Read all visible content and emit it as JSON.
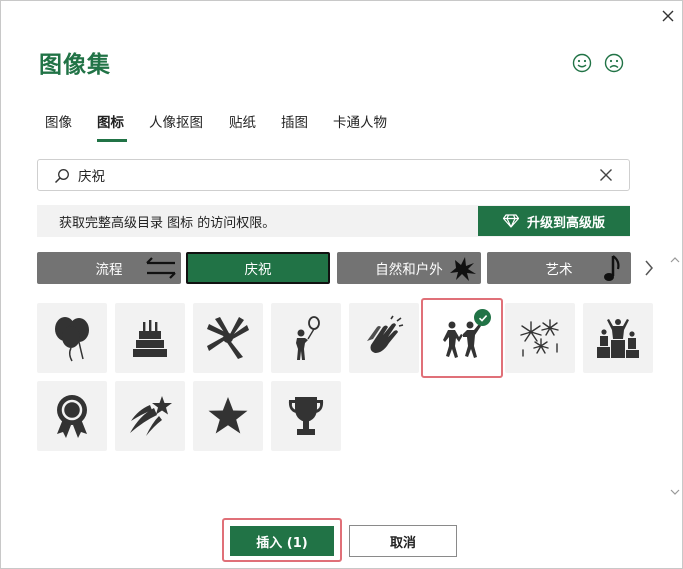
{
  "dialog": {
    "title": "图像集",
    "happy_icon": "smile-icon",
    "sad_icon": "frown-icon",
    "close_icon": "close-icon"
  },
  "tabs": [
    {
      "label": "图像",
      "active": false
    },
    {
      "label": "图标",
      "active": true
    },
    {
      "label": "人像抠图",
      "active": false
    },
    {
      "label": "贴纸",
      "active": false
    },
    {
      "label": "插图",
      "active": false
    },
    {
      "label": "卡通人物",
      "active": false
    }
  ],
  "search": {
    "value": "庆祝",
    "icon": "search-icon",
    "clear_icon": "clear-icon"
  },
  "banner": {
    "text": "获取完整高级目录 图标 的访问权限。",
    "upgrade_label": "升级到高级版",
    "upgrade_icon": "diamond-icon"
  },
  "categories": [
    {
      "label": "流程",
      "active": false,
      "icon": "arrows-icon"
    },
    {
      "label": "庆祝",
      "active": true,
      "icon": ""
    },
    {
      "label": "自然和户外",
      "active": false,
      "icon": "splat-icon"
    },
    {
      "label": "艺术",
      "active": false,
      "icon": "music-note-icon"
    }
  ],
  "icons": [
    {
      "name": "balloons-icon",
      "selected": false
    },
    {
      "name": "birthday-cake-icon",
      "selected": false
    },
    {
      "name": "team-hands-icon",
      "selected": false
    },
    {
      "name": "person-with-balloon-icon",
      "selected": false
    },
    {
      "name": "clapping-hands-icon",
      "selected": false
    },
    {
      "name": "people-celebrating-icon",
      "selected": true
    },
    {
      "name": "fireworks-icon",
      "selected": false
    },
    {
      "name": "podium-icon",
      "selected": false
    },
    {
      "name": "award-ribbon-icon",
      "selected": false
    },
    {
      "name": "shooting-star-icon",
      "selected": false
    },
    {
      "name": "star-icon",
      "selected": false
    },
    {
      "name": "trophy-icon",
      "selected": false
    }
  ],
  "footer": {
    "insert_label": "插入 (1)",
    "cancel_label": "取消"
  },
  "colors": {
    "accent": "#217346",
    "category_bg": "#737373",
    "selection_outline": "#e07078",
    "icon": "#333333"
  }
}
